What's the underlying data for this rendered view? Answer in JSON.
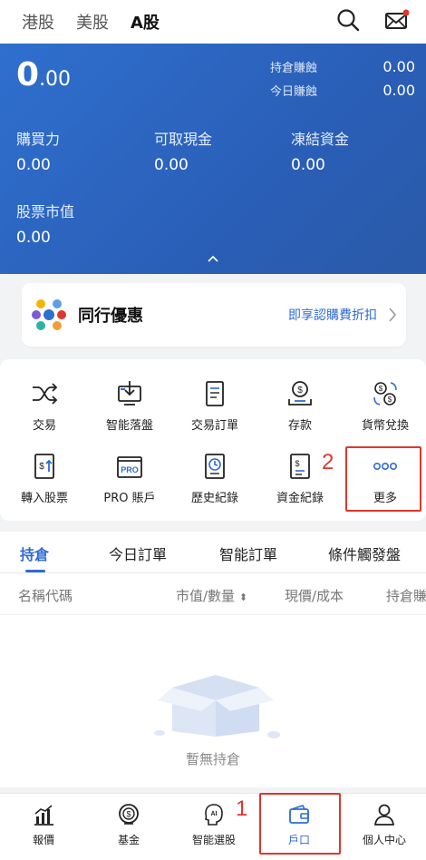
{
  "markets": [
    "港股",
    "美股",
    "A股"
  ],
  "account": {
    "balance_int": "0",
    "balance_dec": ".00",
    "holding_pl_label": "持倉賺蝕",
    "holding_pl_value": "0.00",
    "today_pl_label": "今日賺蝕",
    "today_pl_value": "0.00",
    "buying_power_label": "購買力",
    "buying_power_value": "0.00",
    "withdrawable_label": "可取現金",
    "withdrawable_value": "0.00",
    "frozen_label": "凍結資金",
    "frozen_value": "0.00",
    "stock_value_label": "股票市值",
    "stock_value_value": "0.00"
  },
  "promo": {
    "title": "同行優惠",
    "link": "即享認購費折扣"
  },
  "functions": [
    {
      "label": "交易",
      "icon": "shuffle-icon"
    },
    {
      "label": "智能落盤",
      "icon": "monitor-download-icon"
    },
    {
      "label": "交易訂單",
      "icon": "document-list-icon"
    },
    {
      "label": "存款",
      "icon": "deposit-coin-icon"
    },
    {
      "label": "貨幣兌換",
      "icon": "currency-exchange-icon"
    },
    {
      "label": "轉入股票",
      "icon": "transfer-in-icon"
    },
    {
      "label": "PRO 賬戶",
      "icon": "pro-account-icon"
    },
    {
      "label": "歷史紀錄",
      "icon": "history-clock-icon"
    },
    {
      "label": "資金紀錄",
      "icon": "fund-record-icon"
    },
    {
      "label": "更多",
      "icon": "more-dots-icon"
    }
  ],
  "order_tabs": [
    "持倉",
    "今日訂單",
    "智能訂單",
    "條件觸發盤"
  ],
  "columns": [
    "名稱代碼",
    "市值/數量",
    "現價/成本",
    "持倉賺"
  ],
  "empty_text": "暫無持倉",
  "bottom_nav": [
    {
      "label": "報價",
      "icon": "chart-icon"
    },
    {
      "label": "基金",
      "icon": "fund-icon"
    },
    {
      "label": "智能選股",
      "icon": "ai-pick-icon"
    },
    {
      "label": "戶口",
      "icon": "wallet-icon"
    },
    {
      "label": "個人中心",
      "icon": "person-icon"
    }
  ],
  "annotations": {
    "mark_1": "1",
    "mark_2": "2"
  },
  "colors": {
    "brand_blue": "#2e6bd6",
    "card_blue": "#2a5fb8",
    "highlight_red": "#e0362c"
  }
}
